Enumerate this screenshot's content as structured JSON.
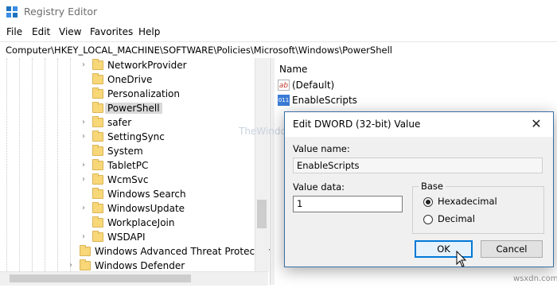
{
  "window": {
    "title": "Registry Editor"
  },
  "menu": [
    "File",
    "Edit",
    "View",
    "Favorites",
    "Help"
  ],
  "address": "Computer\\HKEY_LOCAL_MACHINE\\SOFTWARE\\Policies\\Microsoft\\Windows\\PowerShell",
  "tree": {
    "items": [
      {
        "label": "NetworkProvider",
        "expandable": true
      },
      {
        "label": "OneDrive",
        "expandable": false
      },
      {
        "label": "Personalization",
        "expandable": false
      },
      {
        "label": "PowerShell",
        "expandable": false,
        "selected": true
      },
      {
        "label": "safer",
        "expandable": true
      },
      {
        "label": "SettingSync",
        "expandable": true
      },
      {
        "label": "System",
        "expandable": false
      },
      {
        "label": "TabletPC",
        "expandable": true
      },
      {
        "label": "WcmSvc",
        "expandable": true
      },
      {
        "label": "Windows Search",
        "expandable": false
      },
      {
        "label": "WindowsUpdate",
        "expandable": true
      },
      {
        "label": "WorkplaceJoin",
        "expandable": false
      },
      {
        "label": "WSDAPI",
        "expandable": true
      }
    ],
    "outer_items": [
      {
        "label": "Windows Advanced Threat Protection",
        "expandable": false
      },
      {
        "label": "Windows Defender",
        "expandable": true
      }
    ]
  },
  "values_pane": {
    "column_name": "Name",
    "rows": [
      {
        "label": "(Default)",
        "icon": "string-value-icon",
        "icon_text": "ab"
      },
      {
        "label": "EnableScripts",
        "icon": "dword-value-icon",
        "icon_text": "011"
      }
    ]
  },
  "dialog": {
    "title": "Edit DWORD (32-bit) Value",
    "value_name_label": "Value name:",
    "value_name": "EnableScripts",
    "value_data_label": "Value data:",
    "value_data": "1",
    "base_label": "Base",
    "hex_label": "Hexadecimal",
    "dec_label": "Decimal",
    "selected_base": "Hexadecimal",
    "ok_label": "OK",
    "cancel_label": "Cancel"
  },
  "watermark": "wsxdn.com",
  "watermark_center": "TheWindowsClub",
  "colors": {
    "folder": "#f7d778",
    "accent": "#0078d7"
  }
}
